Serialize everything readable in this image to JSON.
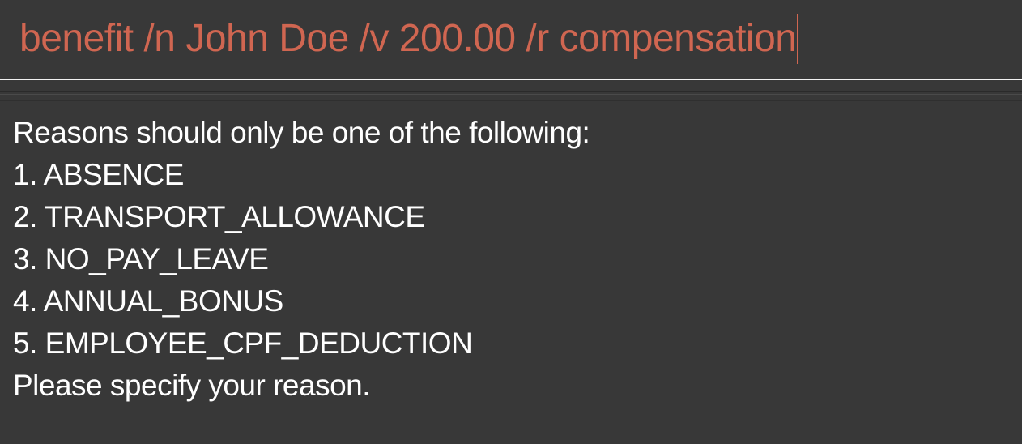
{
  "command_box": {
    "value": "benefit /n John Doe /v 200.00 /r compensation"
  },
  "result_display": {
    "lines": [
      "Reasons should only be one of the following:",
      "1. ABSENCE",
      "2. TRANSPORT_ALLOWANCE",
      "3. NO_PAY_LEAVE",
      "4. ANNUAL_BONUS",
      "5. EMPLOYEE_CPF_DEDUCTION",
      "Please specify your reason."
    ]
  },
  "colors": {
    "background": "#383838",
    "command_text": "#d06651",
    "result_text": "#ffffff",
    "divider": "#f2f2f2"
  }
}
